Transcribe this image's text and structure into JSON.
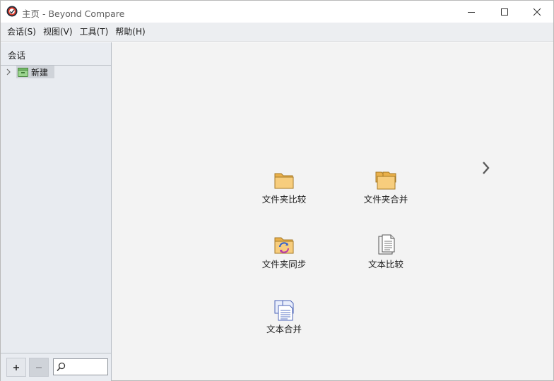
{
  "window": {
    "title": "主页 - Beyond Compare"
  },
  "menu": {
    "items": [
      {
        "label": "会话(S)"
      },
      {
        "label": "视图(V)"
      },
      {
        "label": "工具(T)"
      },
      {
        "label": "帮助(H)"
      }
    ]
  },
  "sidebar": {
    "title": "会话",
    "tree": [
      {
        "label": "新建",
        "selected": true,
        "expanded": false
      }
    ],
    "search": {
      "value": "",
      "placeholder": ""
    }
  },
  "main": {
    "tiles": [
      {
        "label": "文件夹比较",
        "icon": "folder-icon"
      },
      {
        "label": "文件夹合并",
        "icon": "folder-merge-icon"
      },
      {
        "label": "文件夹同步",
        "icon": "folder-sync-icon"
      },
      {
        "label": "文本比较",
        "icon": "text-document-icon"
      },
      {
        "label": "文本合并",
        "icon": "text-merge-icon"
      }
    ]
  },
  "colors": {
    "sidebar_bg": "#e8ebf0",
    "main_bg": "#f3f3f3",
    "menubar_bg": "#eceef1",
    "folder": "#f5c66d",
    "selection": "#cfd3d9"
  }
}
